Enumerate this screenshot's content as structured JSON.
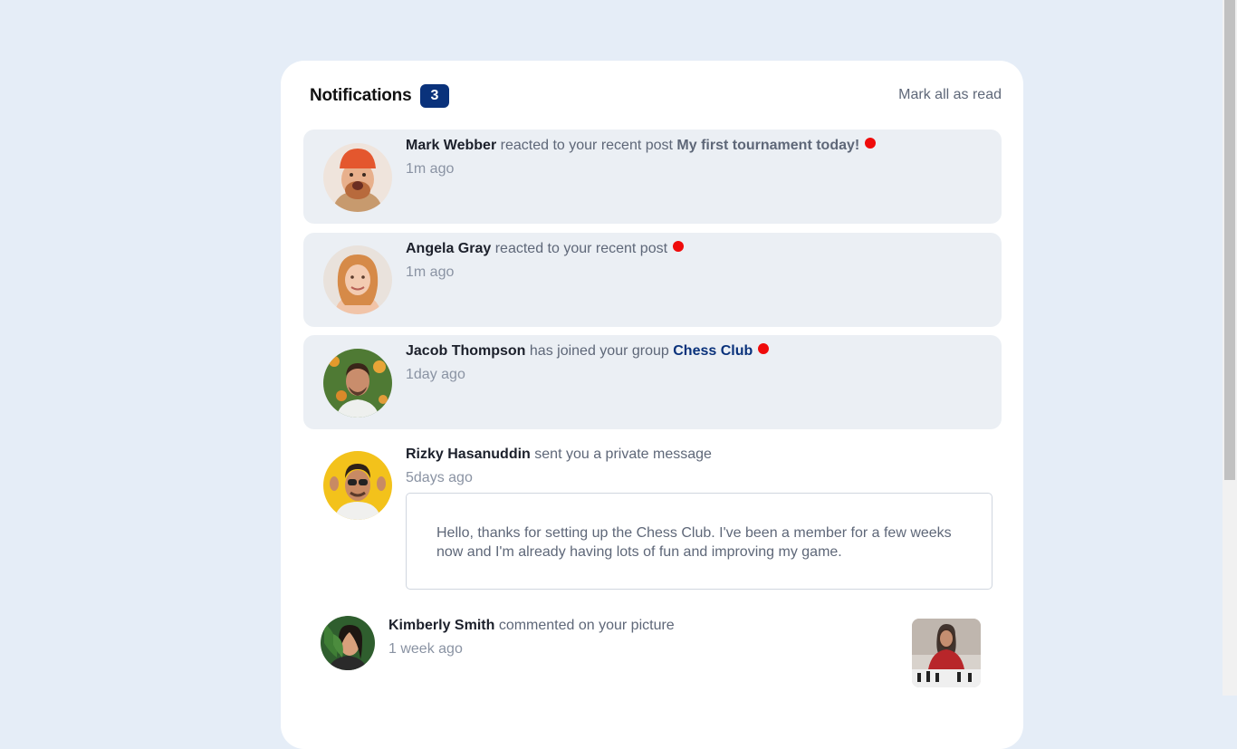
{
  "header": {
    "title": "Notifications",
    "unread_count": "3",
    "mark_all_label": "Mark all as read"
  },
  "notifications": [
    {
      "name": "Mark Webber",
      "action": "reacted to your recent post",
      "target": "My first tournament today!",
      "time": "1m ago",
      "unread": true
    },
    {
      "name": "Angela Gray",
      "action": "reacted to your recent post",
      "time": "1m ago",
      "unread": true
    },
    {
      "name": "Jacob Thompson",
      "action": "has joined your group",
      "target": "Chess Club",
      "time": "1day ago",
      "unread": true
    },
    {
      "name": "Rizky Hasanuddin",
      "action": "sent you a private message",
      "time": "5days ago",
      "unread": false,
      "message": "Hello, thanks for setting up the Chess Club. I've been a member for a few weeks now and I'm already having lots of fun and improving my game."
    },
    {
      "name": "Kimberly Smith",
      "action": "commented on your picture",
      "time": "1 week ago",
      "unread": false
    }
  ],
  "colors": {
    "page_bg": "#e5edf7",
    "badge": "#0a327b",
    "unread_bg": "#ebeff4",
    "dot": "#ef0b0b"
  }
}
